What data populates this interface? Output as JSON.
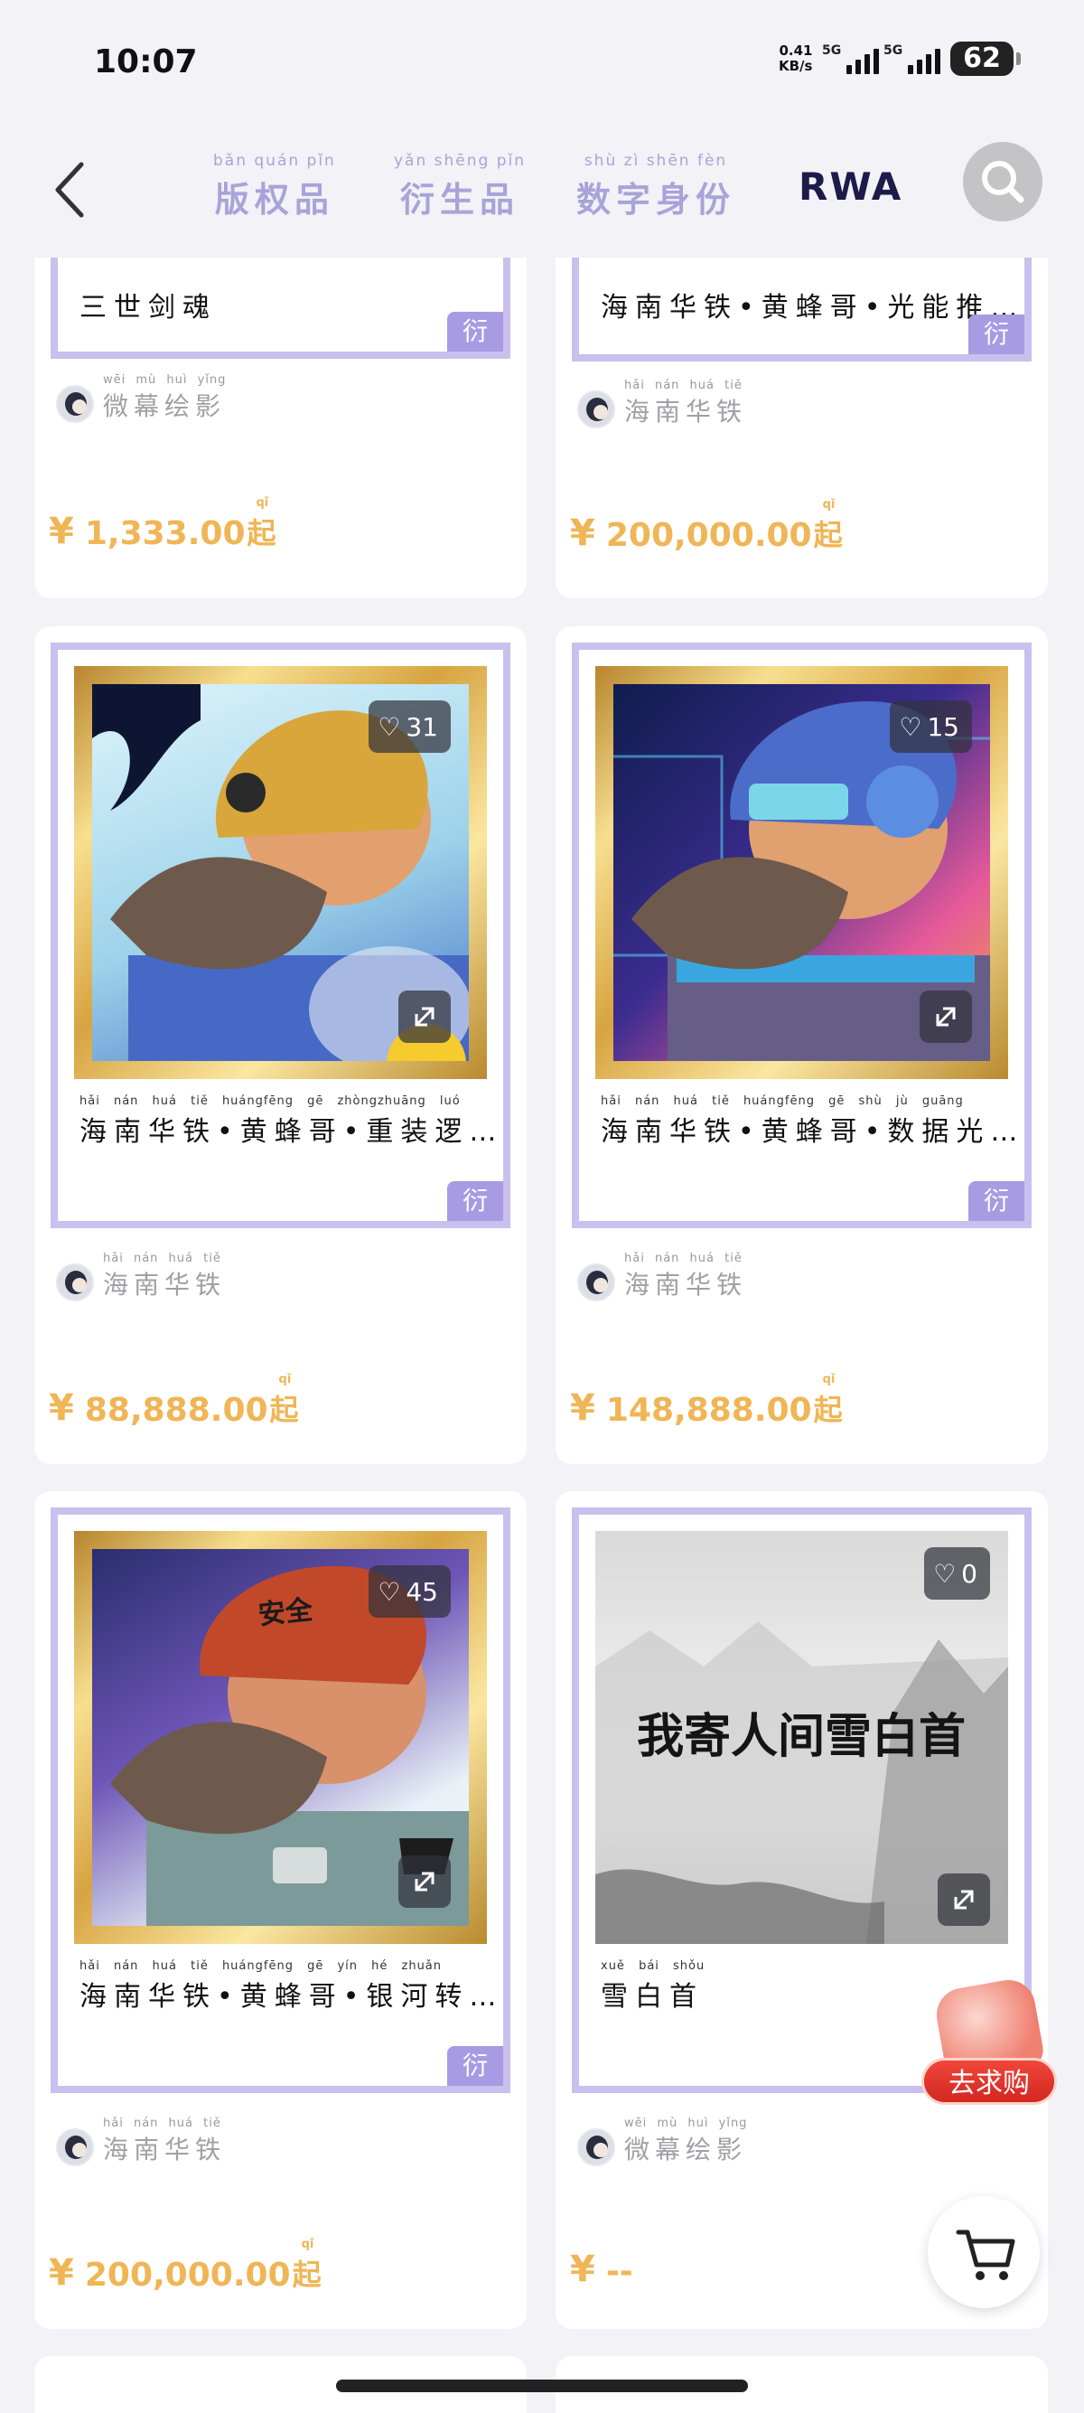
{
  "status": {
    "time": "10:07",
    "speed_value": "0.41",
    "speed_unit": "KB/s",
    "net1": "5G",
    "net2": "5G",
    "battery": "62"
  },
  "nav": {
    "back_icon": "chevron-left-icon",
    "tabs": [
      {
        "label": "版权品",
        "pinyin": "bǎn quán pǐn"
      },
      {
        "label": "衍生品",
        "pinyin": "yǎn shēng pǐn"
      },
      {
        "label": "数字身份",
        "pinyin": "shù zì shēn fèn"
      },
      {
        "label": "RWA",
        "pinyin": ""
      }
    ],
    "active_tab": "RWA",
    "search_icon": "search-icon"
  },
  "colors": {
    "accent": "#a79be3",
    "frame": "#c9c0ee",
    "price": "#f0b555",
    "active_tab": "#1c1b4a",
    "inactive_tab": "#a9a3d8"
  },
  "cards": [
    {
      "title": "三世剑魂",
      "title_pinyin": "",
      "creator": "微幕绘影",
      "creator_pinyin": "wēi mù huì yǐng",
      "badge": "衍",
      "price_currency": "¥",
      "price": "1,333.00",
      "price_suffix": "起",
      "price_suffix_pinyin": "qǐ"
    },
    {
      "title": "海南华铁•黄蜂哥•光能推…",
      "title_pinyin": "",
      "creator": "海南华铁",
      "creator_pinyin": "hǎi nán huá tiě",
      "badge": "衍",
      "price_currency": "¥",
      "price": "200,000.00",
      "price_suffix": "起",
      "price_suffix_pinyin": "qǐ"
    },
    {
      "title": "海南华铁•黄蜂哥•重装逻…",
      "title_pinyin": "hǎi nán huá tiě huángfēng gē zhòngzhuāng luó",
      "likes": "31",
      "creator": "海南华铁",
      "creator_pinyin": "hǎi nán huá tiě",
      "badge": "衍",
      "price_currency": "¥",
      "price": "88,888.00",
      "price_suffix": "起",
      "price_suffix_pinyin": "qǐ"
    },
    {
      "title": "海南华铁•黄蜂哥•数据光…",
      "title_pinyin": "hǎi nán huá tiě huángfēng gē shù jù guāng",
      "likes": "15",
      "creator": "海南华铁",
      "creator_pinyin": "hǎi nán huá tiě",
      "badge": "衍",
      "price_currency": "¥",
      "price": "148,888.00",
      "price_suffix": "起",
      "price_suffix_pinyin": "qǐ"
    },
    {
      "title": "海南华铁•黄蜂哥•银河转…",
      "title_pinyin": "hǎi nán huá tiě huángfēng gē yín hé zhuǎn",
      "likes": "45",
      "helmet_text": "安全",
      "creator": "海南华铁",
      "creator_pinyin": "hǎi nán huá tiě",
      "badge": "衍",
      "price_currency": "¥",
      "price": "200,000.00",
      "price_suffix": "起",
      "price_suffix_pinyin": "qǐ"
    },
    {
      "title": "雪白首",
      "title_pinyin": "xuě bái shǒu",
      "likes": "0",
      "art_text": "我寄人间雪白首",
      "creator": "微幕绘影",
      "creator_pinyin": "wēi mù huì yǐng",
      "price_currency": "¥",
      "price": "--"
    }
  ],
  "float": {
    "promo_label": "去求购",
    "cart_icon": "cart-icon"
  }
}
